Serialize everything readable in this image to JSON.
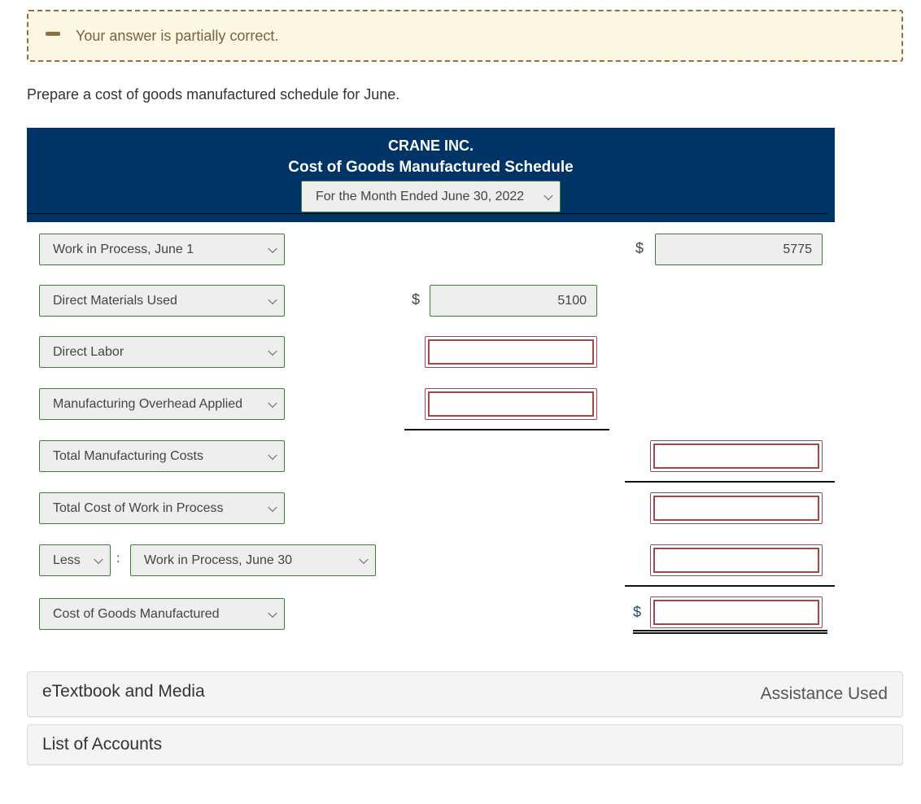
{
  "feedback": {
    "icon": "minus-icon",
    "message": "Your answer is partially correct.",
    "color": "#8a7145"
  },
  "instruction": "Prepare a cost of goods manufactured schedule for June.",
  "header": {
    "company": "CRANE INC.",
    "title": "Cost of Goods Manufactured Schedule",
    "period_selected": "For the Month Ended June 30, 2022",
    "background_color": "#003366"
  },
  "rows": {
    "wip_begin": {
      "label": "Work in Process, June 1",
      "currency": "$",
      "value": "5775"
    },
    "direct_materials": {
      "label": "Direct Materials Used",
      "currency": "$",
      "value": "5100"
    },
    "direct_labor": {
      "label": "Direct Labor",
      "value": ""
    },
    "overhead": {
      "label": "Manufacturing Overhead Applied",
      "value": ""
    },
    "total_mfg": {
      "label": "Total Manufacturing Costs",
      "value": ""
    },
    "total_wip": {
      "label": "Total Cost of Work in Process",
      "value": ""
    },
    "wip_end": {
      "operator": "Less",
      "separator": ":",
      "label": "Work in Process, June 30",
      "value": ""
    },
    "cogm": {
      "label": "Cost of Goods Manufactured",
      "currency": "$",
      "value": ""
    }
  },
  "panels": {
    "etextbook": "eTextbook and Media",
    "assistance": "Assistance Used",
    "accounts": "List of Accounts"
  },
  "colors": {
    "select_border": "#3f7a3f",
    "incorrect_border": "#a04848"
  }
}
